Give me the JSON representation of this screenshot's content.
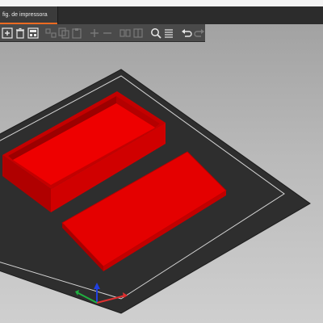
{
  "tab": {
    "label": "fig. de impressora"
  },
  "toolbar": {
    "items": [
      {
        "name": "add-icon",
        "enabled": true
      },
      {
        "name": "delete-icon",
        "enabled": true
      },
      {
        "name": "delete-all-icon",
        "enabled": true
      },
      {
        "name": "arrange-icon",
        "enabled": false
      },
      {
        "name": "copy-icon",
        "enabled": false
      },
      {
        "name": "paste-icon",
        "enabled": false
      },
      {
        "name": "add-instance-icon",
        "enabled": false
      },
      {
        "name": "remove-instance-icon",
        "enabled": false
      },
      {
        "name": "split-objects-icon",
        "enabled": false
      },
      {
        "name": "split-parts-icon",
        "enabled": false
      },
      {
        "name": "search-icon",
        "enabled": true
      },
      {
        "name": "layers-editing-icon",
        "enabled": true
      },
      {
        "name": "undo-icon",
        "enabled": true
      },
      {
        "name": "redo-icon",
        "enabled": false
      }
    ]
  },
  "colors": {
    "accent": "#ED6B21",
    "model": "#E00000",
    "bed": "#2E2E2E",
    "axis_x": "#E03030",
    "axis_y": "#20B040",
    "axis_z": "#2040E0"
  }
}
